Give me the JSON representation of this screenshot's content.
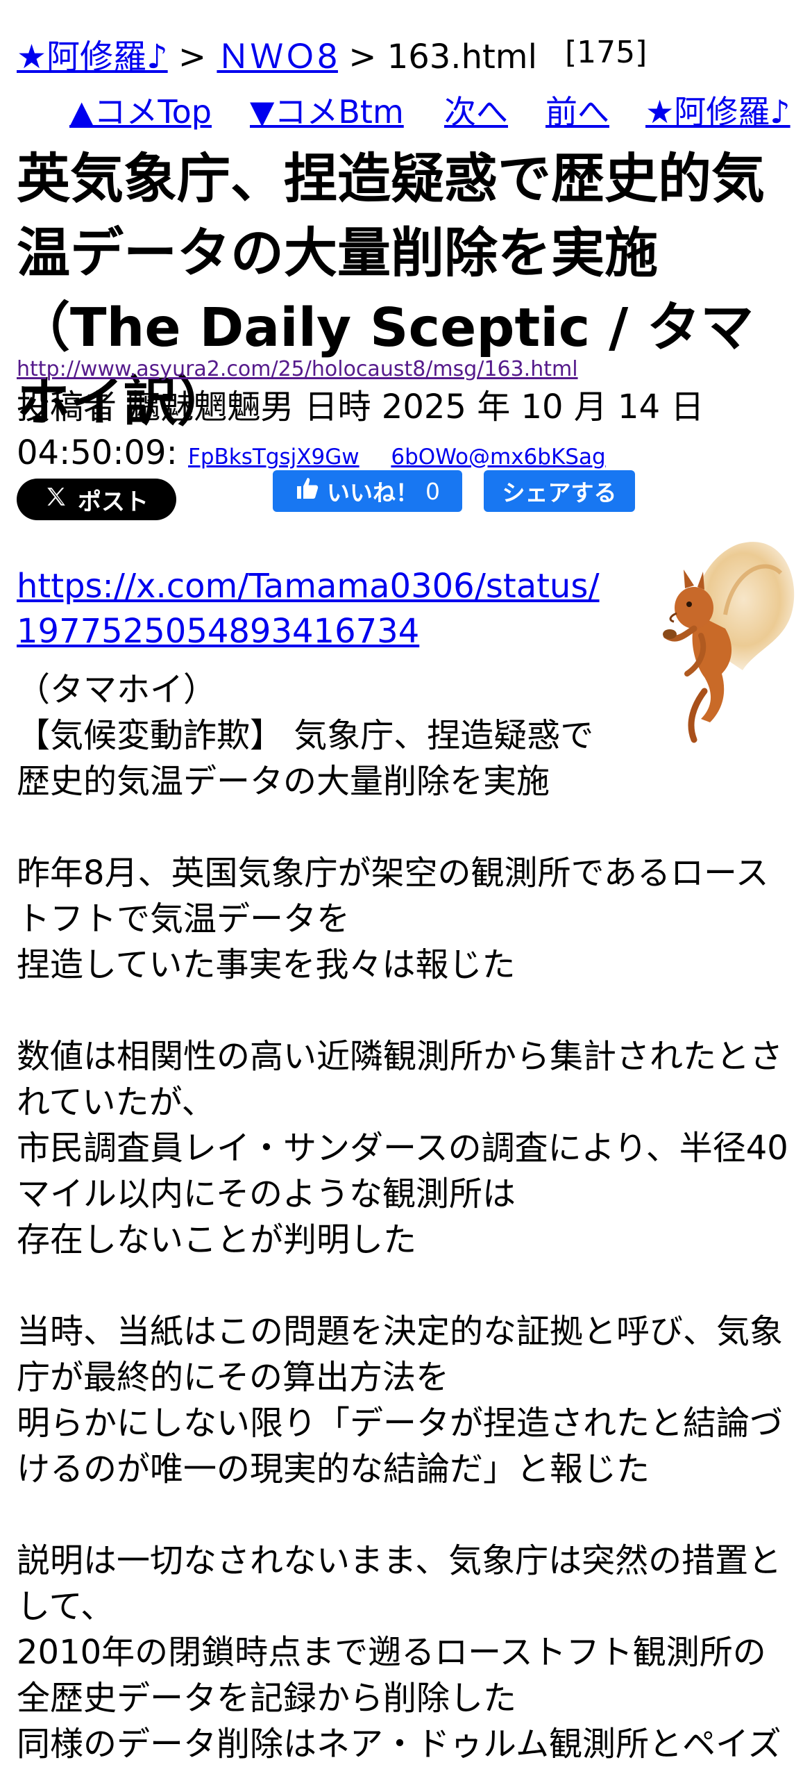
{
  "breadcrumb": {
    "home": "★阿修羅♪",
    "sep1": " > ",
    "board": "ＮＷＯ8",
    "sep2": " > ",
    "page": "163.html"
  },
  "comment_count": "[175]",
  "nav": {
    "comment_top": "▲コメTop",
    "comment_bottom": "▼コメBtm",
    "next": "次へ",
    "prev": "前へ",
    "home": "★阿修羅♪"
  },
  "article": {
    "title": "英気象庁、捏造疑惑で歴史的気温データの大量削除を実施　（The Daily Sceptic / タマホイ訳）",
    "url": "http://www.asyura2.com/25/holocaust8/msg/163.html",
    "author_line": "投稿者 魑魅魍魎男 日時 2025 年 10 月 14 日",
    "time": "04:50:09: ",
    "id1": "FpBksTgsjX9Gw",
    "id2": "6bOWo@mx6bKSag"
  },
  "share": {
    "x_label": "ポスト",
    "like_label": "いいね！",
    "like_count": "0",
    "share_label": "シェアする"
  },
  "body": {
    "link": "https://x.com/Tamama0306/status/1977525054893416734",
    "link_line1": "https://x.com/Tamama0306/status/",
    "link_line2": "1977525054893416734",
    "source": "（タマホイ）",
    "headline_1": "【気候変動詐欺】 気象庁、捏造疑惑で",
    "headline_2": "歴史的気温データの大量削除を実施",
    "p1_l1": "昨年8月、英国気象庁が架空の観測所であるロース",
    "p1_l2": "トフトで気温データを",
    "p1_l3": "捏造していた事実を我々は報じた",
    "p2_l1": "数値は相関性の高い近隣観測所から集計されたとさ",
    "p2_l2": "れていたが、",
    "p2_l3": "市民調査員レイ・サンダースの調査により、半径40",
    "p2_l4": "マイル以内にそのような観測所は",
    "p2_l5": "存在しないことが判明した",
    "p3_l1": "当時、当紙はこの問題を決定的な証拠と呼び、気象",
    "p3_l2": "庁が最終的にその算出方法を",
    "p3_l3": "明らかにしない限り「データが捏造されたと結論づ",
    "p3_l4": "けるのが唯一の現実的な結論だ」と報じた",
    "p4_l1": "説明は一切なされないまま、気象庁は突然の措置と",
    "p4_l2": "して、",
    "p4_l3": "2010年の閉鎖時点まで遡るローストフト観測所の",
    "p4_l4": "全歴史データを記録から削除した",
    "p4_l5": "同様のデータ削除はネア・ドゥルム観測所とペイズ"
  },
  "colors": {
    "link": "#0000ee",
    "visited": "#551a8b",
    "facebook": "#1877f2",
    "x": "#000000"
  },
  "icons": [
    "x-logo-icon",
    "thumbs-up-icon",
    "squirrel-image"
  ]
}
